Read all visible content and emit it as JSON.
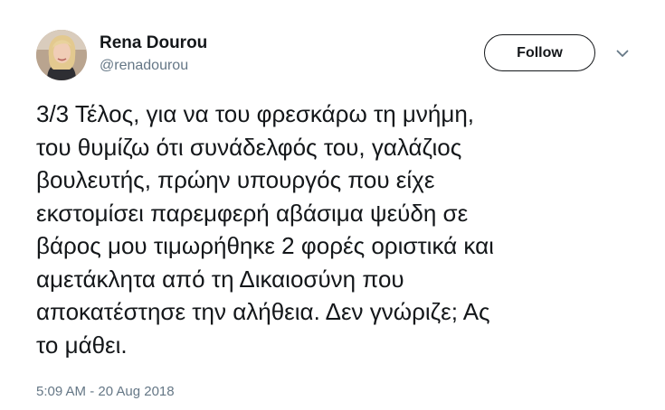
{
  "author": {
    "name": "Rena Dourou",
    "handle": "@renadourou"
  },
  "actions": {
    "follow_label": "Follow",
    "more_icon": "chevron-down-icon"
  },
  "tweet": {
    "lines": [
      "3/3 Τέλος, για να του φρεσκάρω τη μνήμη,",
      "του θυμίζω ότι συνάδελφός του, γαλάζιος",
      "βουλευτής, πρώην υπουργός που είχε",
      "εκστομίσει παρεμφερή αβάσιμα ψεύδη σε",
      "βάρος μου τιμωρήθηκε 2 φορές οριστικά και",
      "αμετάκλητα από τη Δικαιοσύνη που",
      "αποκατέστησε την αλήθεια. Δεν γνώριζε; Ας",
      "το μάθει."
    ],
    "timestamp": "5:09 AM - 20 Aug 2018"
  },
  "colors": {
    "text": "#14171a",
    "secondary": "#657786"
  }
}
